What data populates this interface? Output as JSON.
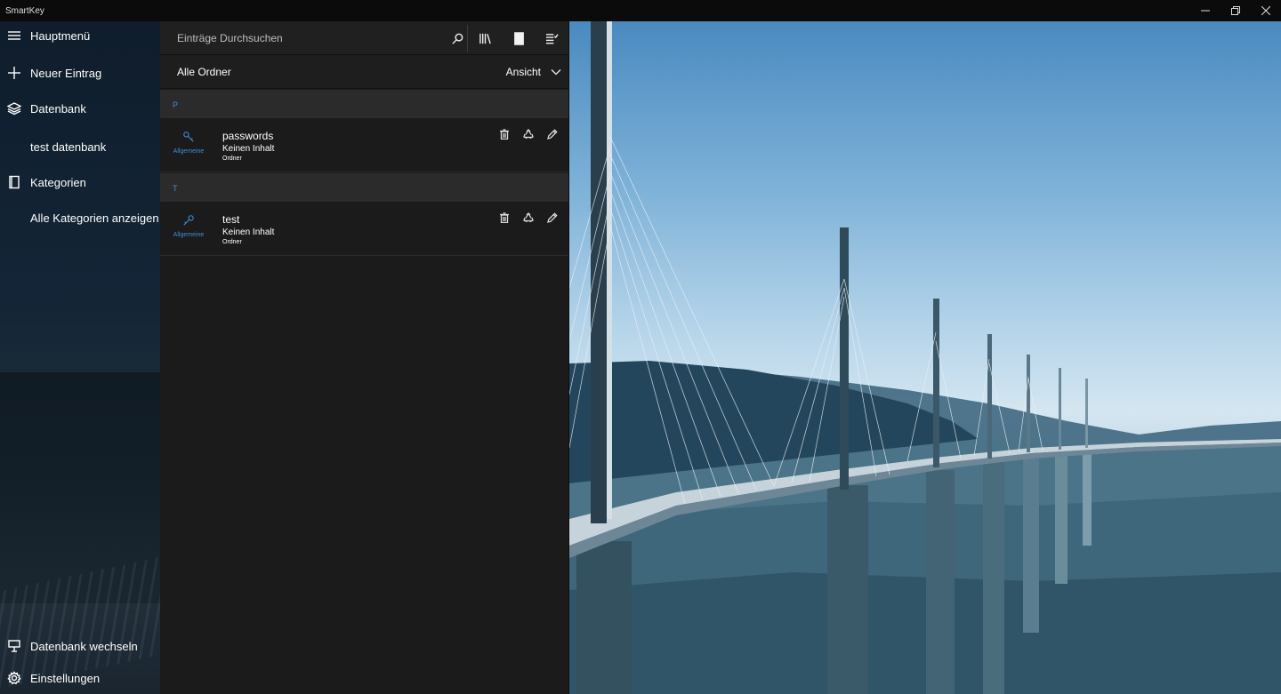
{
  "window": {
    "title": "SmartKey"
  },
  "sidebar": {
    "items": [
      {
        "label": "Hauptmenü",
        "icon": "hamburger-icon"
      },
      {
        "label": "Neuer Eintrag",
        "icon": "plus-icon"
      },
      {
        "label": "Datenbank",
        "icon": "layers-icon"
      },
      {
        "label": "test datenbank",
        "icon": ""
      },
      {
        "label": "Kategorien",
        "icon": "book-icon"
      },
      {
        "label": "Alle Kategorien anzeigen",
        "icon": ""
      }
    ],
    "bottom_items": [
      {
        "label": "Datenbank wechseln",
        "icon": "switch-database-icon"
      },
      {
        "label": "Einstellungen",
        "icon": "gear-icon"
      }
    ]
  },
  "search": {
    "placeholder": "Einträge Durchsuchen"
  },
  "folderbar": {
    "title": "Alle Ordner",
    "view_label": "Ansicht"
  },
  "groups": [
    {
      "letter": "P",
      "entries": [
        {
          "title": "passwords",
          "subtitle": "Keinen Inhalt",
          "type": "Ordner",
          "category": "Allgemeine",
          "icon": "key-icon"
        }
      ]
    },
    {
      "letter": "T",
      "entries": [
        {
          "title": "test",
          "subtitle": "Keinen Inhalt",
          "type": "Ordner",
          "category": "Allgemeine",
          "icon": "key-icon"
        }
      ]
    }
  ],
  "colors": {
    "accent": "#3d8fd8",
    "pane_background": "#1b1b1b",
    "group_header": "#2b2b2b"
  }
}
